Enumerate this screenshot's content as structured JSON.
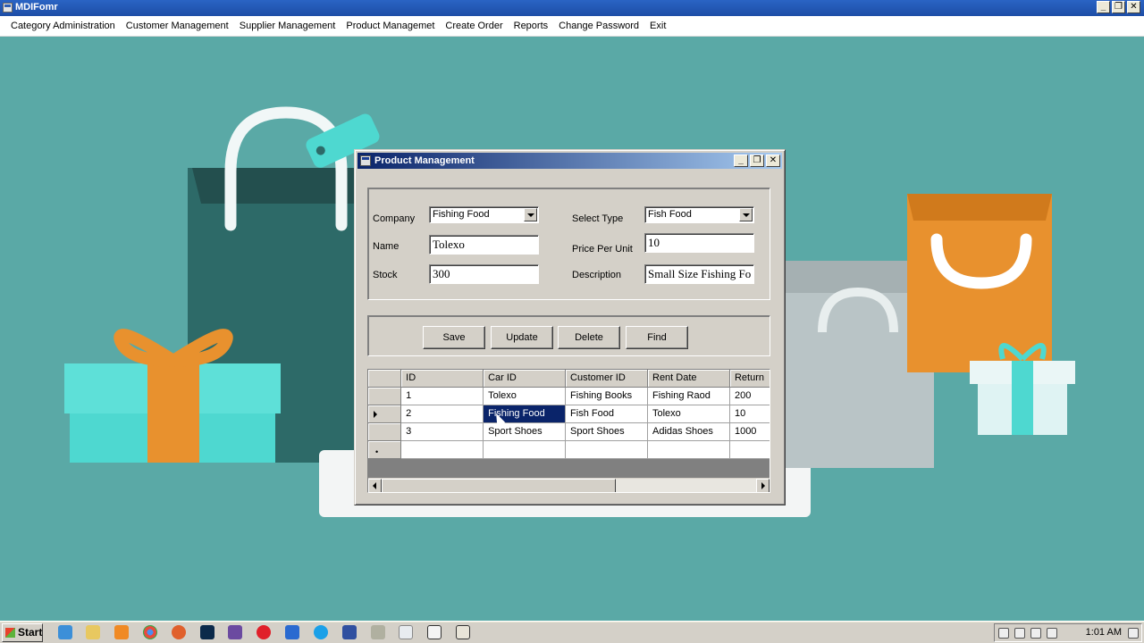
{
  "mdi": {
    "title": "MDIFomr",
    "menu": [
      "Category Administration",
      "Customer Management",
      "Supplier Management",
      "Product Managemet",
      "Create Order",
      "Reports",
      "Change Password",
      "Exit"
    ]
  },
  "window_buttons": {
    "minimize": "_",
    "restore": "❐",
    "close": "✕"
  },
  "form": {
    "title": "Product Management",
    "labels": {
      "company": "Company",
      "name": "Name",
      "stock": "Stock",
      "select_type": "Select Type",
      "price_per_unit": "Price Per Unit",
      "description": "Description"
    },
    "values": {
      "company": "Fishing Food",
      "name": "Tolexo",
      "stock": "300",
      "select_type": "Fish Food",
      "price_per_unit": "10",
      "description": "Small Size Fishing Fo"
    },
    "buttons": {
      "save": "Save",
      "update": "Update",
      "delete": "Delete",
      "find": "Find"
    }
  },
  "grid": {
    "columns": [
      "ID",
      "Car ID",
      "Customer ID",
      "Rent Date",
      "Return"
    ],
    "rows": [
      [
        "1",
        "Tolexo",
        "Fishing Books",
        "Fishing Raod",
        "200"
      ],
      [
        "2",
        "Fishing Food",
        "Fish Food",
        "Tolexo",
        "10"
      ],
      [
        "3",
        "Sport Shoes",
        "Sport Shoes",
        "Adidas Shoes",
        "1000"
      ]
    ],
    "current_row": 2,
    "selected_cell": "Fishing Food"
  },
  "taskbar": {
    "start_label": "Start",
    "clock": "1:01 AM",
    "icons": [
      "ie-icon",
      "folder-icon",
      "media-player-icon",
      "chrome-icon",
      "firefox-icon",
      "photoshop-icon",
      "visual-studio-icon",
      "opera-icon",
      "lync-icon",
      "skype-icon",
      "connector-icon",
      "tools-icon",
      "notepad-icon",
      "cmd-icon",
      "app-window-icon"
    ]
  },
  "colors": {
    "desktop": "#5aa9a6",
    "titlebar": "#0a246a",
    "selection": "#0a246a",
    "orange": "#e8912e",
    "teal_gift": "#4ed8d0"
  }
}
